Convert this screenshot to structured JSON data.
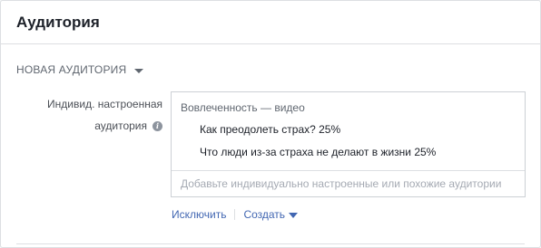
{
  "panel": {
    "title": "Аудитория"
  },
  "section": {
    "toggle_label": "Новая аудитория",
    "toggle_icon": "caret-down-icon"
  },
  "field": {
    "label_line1": "Индивид. настроенная",
    "label_line2": "аудитория",
    "info_icon": "i"
  },
  "audience_box": {
    "group_label": "Вовлеченность — видео",
    "items": [
      "Как преодолеть страх? 25%",
      "Что люди из-за страха не делают в жизни 25%"
    ],
    "input_placeholder": "Добавьте индивидуально настроенные или похожие аудитории",
    "input_value": ""
  },
  "actions": {
    "exclude_label": "Исключить",
    "create_label": "Создать"
  },
  "colors": {
    "link": "#4267b2",
    "border": "#dddfe2",
    "muted_text": "#606770"
  }
}
